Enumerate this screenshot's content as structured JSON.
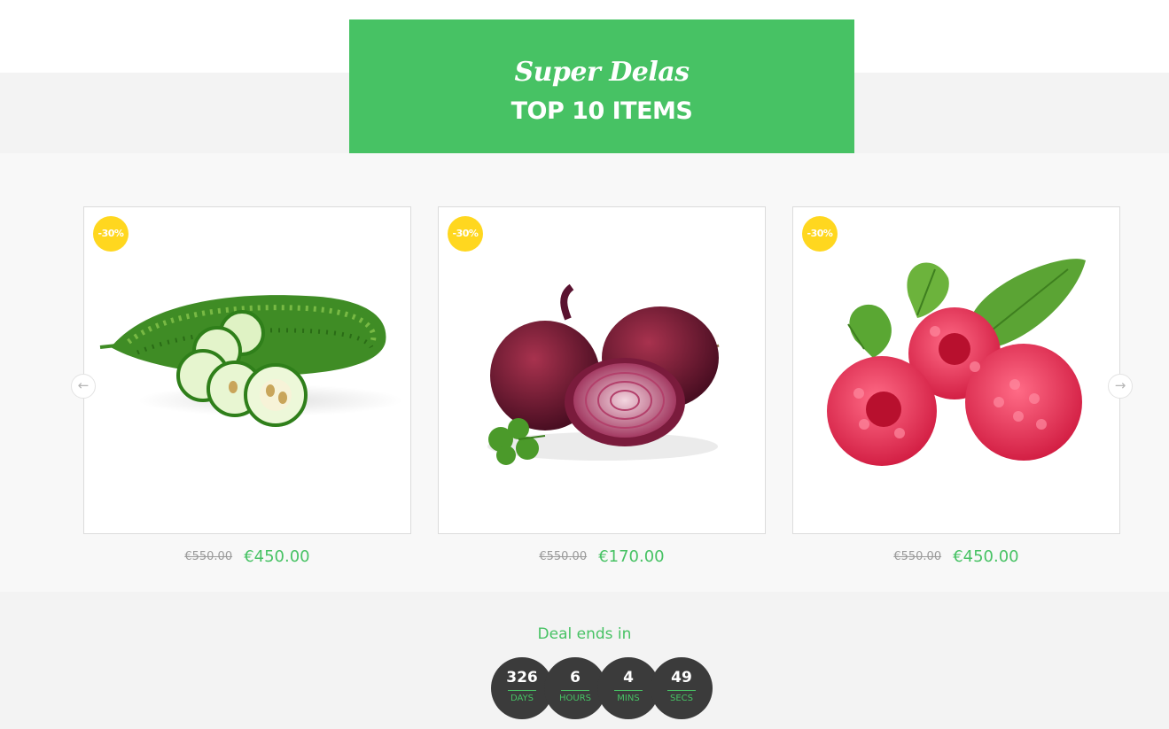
{
  "hero": {
    "script_title": "Super Delas",
    "title": "TOP 10 ITEMS"
  },
  "products": [
    {
      "badge": "-30%",
      "old_price": "€550.00",
      "price": "€450.00",
      "image": "bitter-gourd"
    },
    {
      "badge": "-30%",
      "old_price": "€550.00",
      "price": "€170.00",
      "image": "red-onion"
    },
    {
      "badge": "-30%",
      "old_price": "€550.00",
      "price": "€450.00",
      "image": "raspberries"
    }
  ],
  "carousel": {
    "prev_icon": "arrow-left-icon",
    "next_icon": "arrow-right-icon",
    "prev_glyph": "←",
    "next_glyph": "→"
  },
  "deal": {
    "label": "Deal ends in",
    "countdown": [
      {
        "value": "326",
        "unit": "DAYS"
      },
      {
        "value": "6",
        "unit": "HOURS"
      },
      {
        "value": "4",
        "unit": "MINS"
      },
      {
        "value": "49",
        "unit": "SECS"
      }
    ]
  },
  "colors": {
    "accent_green": "#47c264",
    "badge_yellow": "#ffd71f",
    "timer_dark": "#3b3b3b"
  }
}
